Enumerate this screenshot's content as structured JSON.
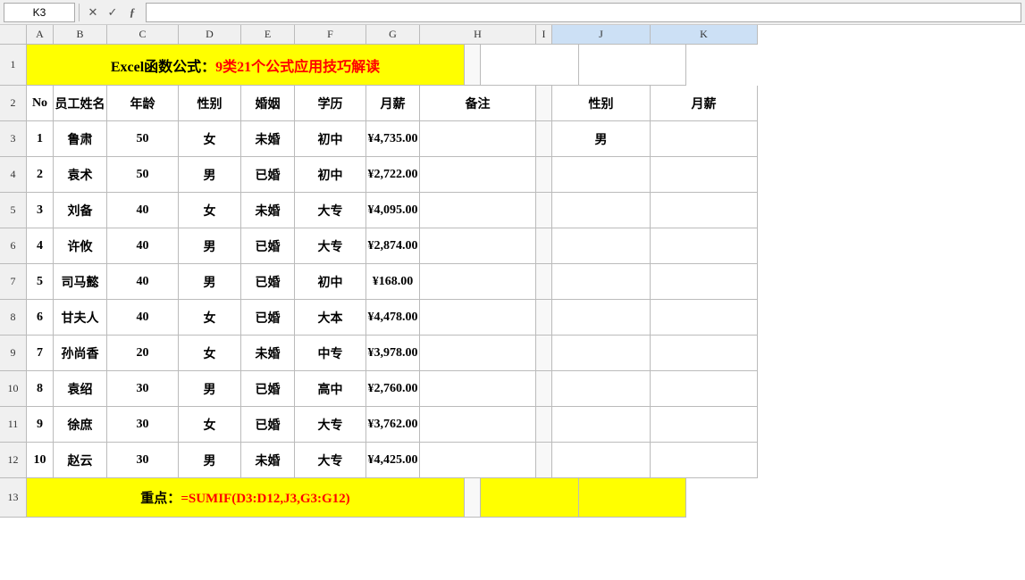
{
  "namebox": "K3",
  "formula": "",
  "columns": [
    "A",
    "B",
    "C",
    "D",
    "E",
    "F",
    "G",
    "H",
    "I",
    "J",
    "K"
  ],
  "title": {
    "prefix": "Excel函数公式：",
    "main": "9类21个公式应用技巧解读"
  },
  "headers": {
    "no": "No",
    "name": "员工姓名",
    "age": "年龄",
    "gender": "性别",
    "marriage": "婚姻",
    "education": "学历",
    "salary": "月薪",
    "note": "备注",
    "gender2": "性别",
    "salary2": "月薪"
  },
  "rows": [
    {
      "no": "1",
      "name": "鲁肃",
      "age": "50",
      "gender": "女",
      "marriage": "未婚",
      "education": "初中",
      "salary": "¥4,735.00",
      "note": ""
    },
    {
      "no": "2",
      "name": "袁术",
      "age": "50",
      "gender": "男",
      "marriage": "已婚",
      "education": "初中",
      "salary": "¥2,722.00",
      "note": ""
    },
    {
      "no": "3",
      "name": "刘备",
      "age": "40",
      "gender": "女",
      "marriage": "未婚",
      "education": "大专",
      "salary": "¥4,095.00",
      "note": ""
    },
    {
      "no": "4",
      "name": "许攸",
      "age": "40",
      "gender": "男",
      "marriage": "已婚",
      "education": "大专",
      "salary": "¥2,874.00",
      "note": ""
    },
    {
      "no": "5",
      "name": "司马懿",
      "age": "40",
      "gender": "男",
      "marriage": "已婚",
      "education": "初中",
      "salary": "¥168.00",
      "note": ""
    },
    {
      "no": "6",
      "name": "甘夫人",
      "age": "40",
      "gender": "女",
      "marriage": "已婚",
      "education": "大本",
      "salary": "¥4,478.00",
      "note": ""
    },
    {
      "no": "7",
      "name": "孙尚香",
      "age": "20",
      "gender": "女",
      "marriage": "未婚",
      "education": "中专",
      "salary": "¥3,978.00",
      "note": ""
    },
    {
      "no": "8",
      "name": "袁绍",
      "age": "30",
      "gender": "男",
      "marriage": "已婚",
      "education": "高中",
      "salary": "¥2,760.00",
      "note": ""
    },
    {
      "no": "9",
      "name": "徐庶",
      "age": "30",
      "gender": "女",
      "marriage": "已婚",
      "education": "大专",
      "salary": "¥3,762.00",
      "note": ""
    },
    {
      "no": "10",
      "name": "赵云",
      "age": "30",
      "gender": "男",
      "marriage": "未婚",
      "education": "大专",
      "salary": "¥4,425.00",
      "note": ""
    }
  ],
  "filter_gender": "男",
  "filter_salary": "",
  "bottom": {
    "prefix": "重点：",
    "formula": "=SUMIF(D3:D12,J3,G3:G12)"
  }
}
